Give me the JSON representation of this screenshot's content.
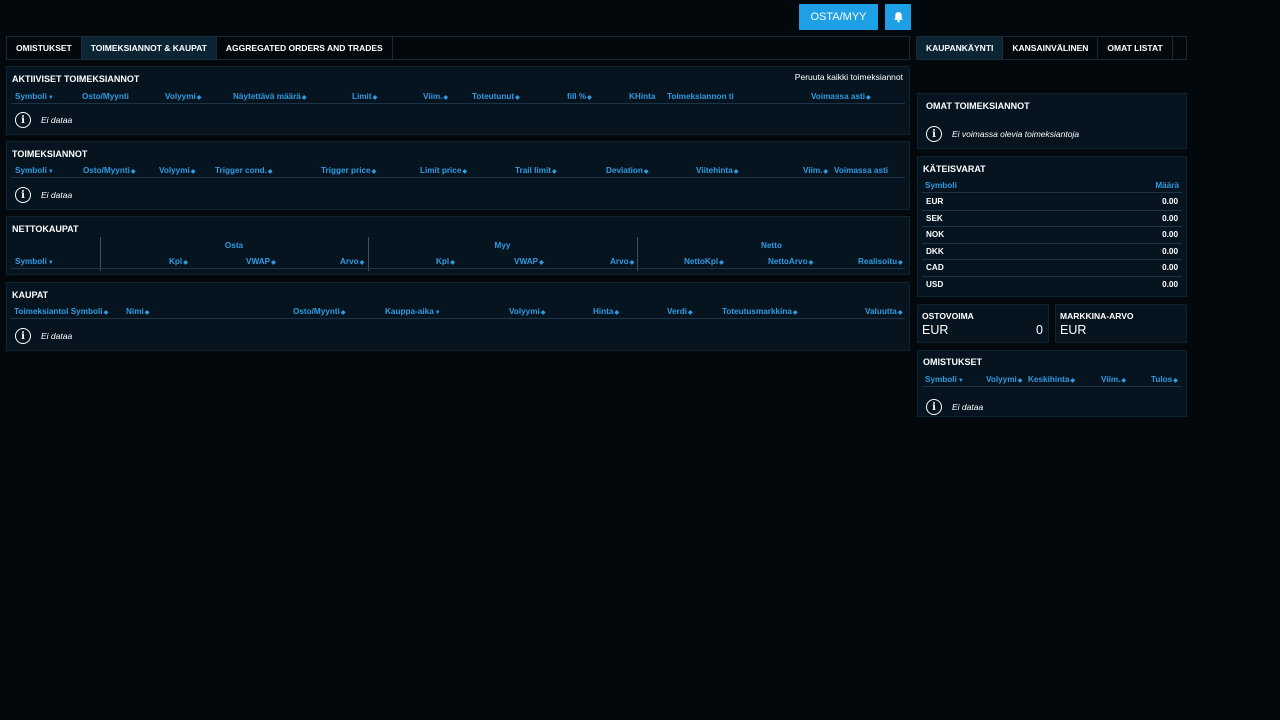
{
  "header": {
    "buy_sell_label": "OSTA/MYY"
  },
  "left_tabs": [
    {
      "label": "OMISTUKSET"
    },
    {
      "label": "TOIMEKSIANNOT & KAUPAT"
    },
    {
      "label": "AGGREGATED ORDERS AND TRADES"
    }
  ],
  "right_tabs": [
    {
      "label": "KAUPANKÄYNTI"
    },
    {
      "label": "KANSAINVÄLINEN"
    },
    {
      "label": "OMAT LISTAT"
    }
  ],
  "active_orders": {
    "title": "AKTIIVISET TOIMEKSIANNOT",
    "cancel_all": "Peruuta kaikki toimeksiannot",
    "columns": [
      "Symboli",
      "Osto/Myynti",
      "Volyymi",
      "Näytettävä määrä",
      "Limit",
      "Viim.",
      "Toteutunut",
      "fill %",
      "KHinta",
      "Toimeksiannon ti",
      "Voimassa asti"
    ],
    "empty": "Ei dataa"
  },
  "orders": {
    "title": "TOIMEKSIANNOT",
    "columns": [
      "Symboli",
      "Osto/Myynti",
      "Volyymi",
      "Trigger cond.",
      "Trigger price",
      "Limit price",
      "Trail limit",
      "Deviation",
      "Viitehinta",
      "Viim.",
      "Voimassa asti"
    ],
    "empty": "Ei dataa"
  },
  "net_trades": {
    "title": "NETTOKAUPAT",
    "groups": [
      "Osta",
      "Myy",
      "Netto"
    ],
    "columns": [
      "Symboli",
      "Kpl",
      "VWAP",
      "Arvo",
      "Kpl",
      "VWAP",
      "Arvo",
      "NettoKpl",
      "NettoArvo",
      "Realisoitu"
    ]
  },
  "trades": {
    "title": "KAUPAT",
    "columns": [
      "Toimeksiantol Symboli",
      "Nimi",
      "Osto/Myynti",
      "Kauppa-aika",
      "Volyymi",
      "Hinta",
      "Verdi",
      "Toteutusmarkkina",
      "Valuutta"
    ],
    "empty": "Ei dataa"
  },
  "my_orders": {
    "title": "OMAT TOIMEKSIANNOT",
    "empty": "Ei voimassa olevia toimeksiantoja"
  },
  "cash": {
    "title": "KÄTEISVARAT",
    "col_symbol": "Symboli",
    "col_amount": "Määrä",
    "rows": [
      {
        "currency": "EUR",
        "amount": "0.00"
      },
      {
        "currency": "SEK",
        "amount": "0.00"
      },
      {
        "currency": "NOK",
        "amount": "0.00"
      },
      {
        "currency": "DKK",
        "amount": "0.00"
      },
      {
        "currency": "CAD",
        "amount": "0.00"
      },
      {
        "currency": "USD",
        "amount": "0.00"
      }
    ]
  },
  "buying_power": {
    "title": "OSTOVOIMA",
    "currency": "EUR",
    "value": "0"
  },
  "market_value": {
    "title": "MARKKINA-ARVO",
    "currency": "EUR"
  },
  "holdings": {
    "title": "OMISTUKSET",
    "columns": [
      "Symboli",
      "Volyymi",
      "Keskihinta",
      "Viim.",
      "Tulos"
    ],
    "empty": "Ei dataa"
  },
  "colors": {
    "accent": "#1ea0e6",
    "header_text": "#2e9be0",
    "panel_bg": "#061420",
    "page_bg": "#03080c"
  },
  "icons": [
    "bell-icon",
    "info-icon",
    "sort-icon",
    "sort-down-icon"
  ]
}
